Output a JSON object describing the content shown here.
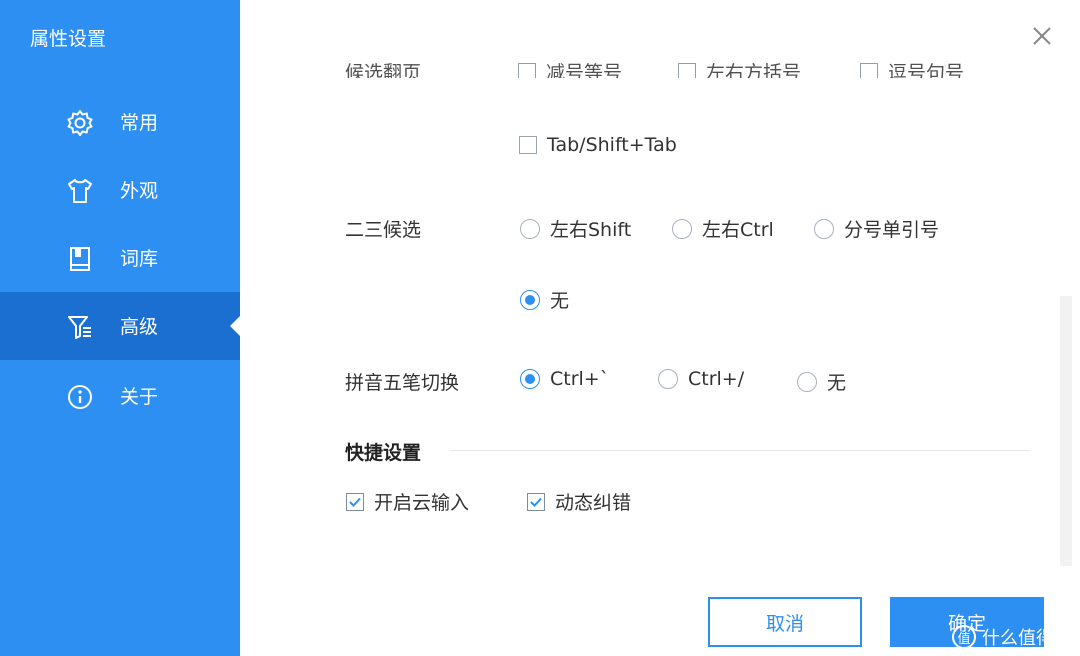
{
  "window": {
    "title": "属性设置"
  },
  "sidebar": {
    "items": [
      {
        "label": "常用"
      },
      {
        "label": "外观"
      },
      {
        "label": "词库"
      },
      {
        "label": "高级"
      },
      {
        "label": "关于"
      }
    ],
    "active": "高级"
  },
  "settings": {
    "top_cut": {
      "label": "候选翻页",
      "opt1": "减号等号",
      "opt2": "左右方括号",
      "opt3": "逗号句号"
    },
    "tab_option": {
      "label": "Tab/Shift+Tab",
      "checked": false
    },
    "second_third_candidate": {
      "label": "二三候选",
      "options": [
        "左右Shift",
        "左右Ctrl",
        "分号单引号",
        "无"
      ],
      "selected": "无"
    },
    "pinyin_wubi_switch": {
      "label": "拼音五笔切换",
      "options": [
        "Ctrl+`",
        "Ctrl+/",
        "无"
      ],
      "selected": "Ctrl+`"
    },
    "shortcut_section": {
      "title": "快捷设置",
      "options": [
        {
          "label": "开启云输入",
          "checked": true
        },
        {
          "label": "动态纠错",
          "checked": true
        }
      ]
    }
  },
  "buttons": {
    "cancel": "取消",
    "ok": "确定"
  },
  "watermark": {
    "text": "什么值得买",
    "icon": "值"
  },
  "colors": {
    "sidebar": "#2e8ff2",
    "active": "#1a6fd1",
    "accent": "#2e8ff2"
  }
}
